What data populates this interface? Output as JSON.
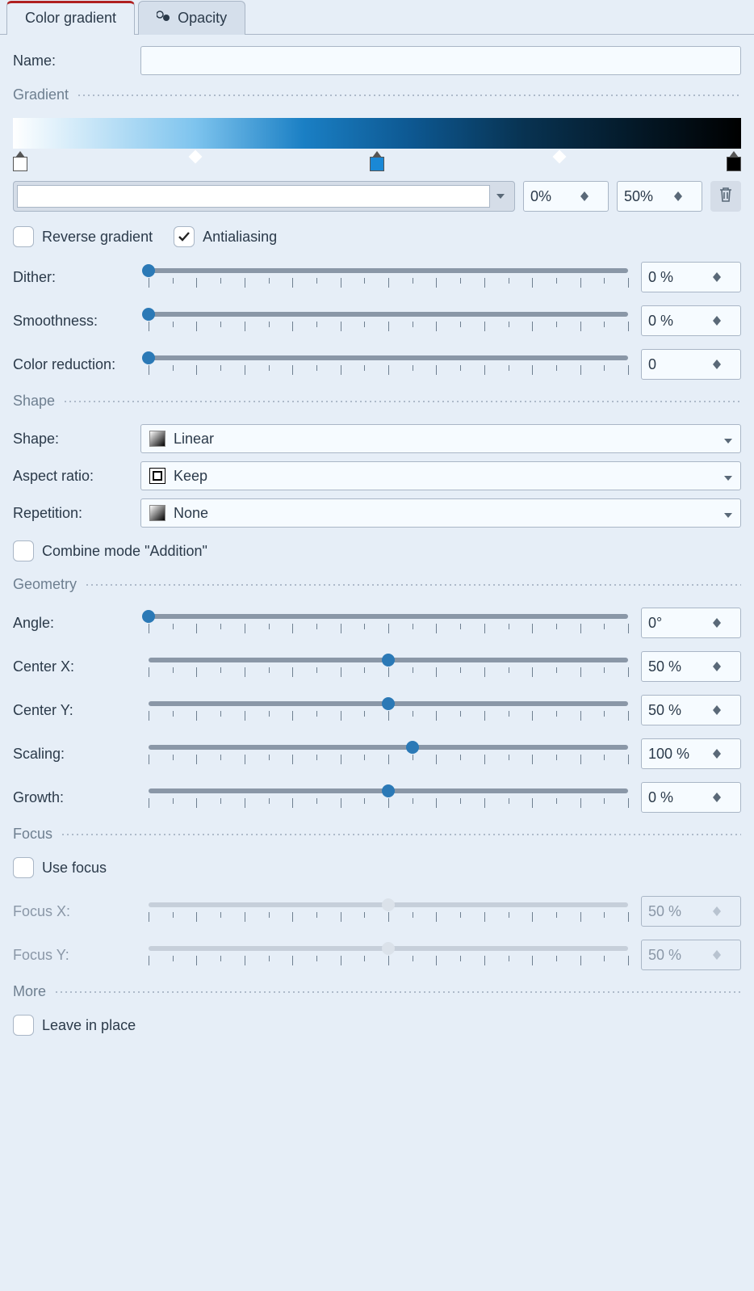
{
  "tabs": {
    "color_gradient": "Color gradient",
    "opacity": "Opacity"
  },
  "name": {
    "label": "Name:",
    "value": ""
  },
  "sections": {
    "gradient": "Gradient",
    "shape": "Shape",
    "geometry": "Geometry",
    "focus": "Focus",
    "more": "More"
  },
  "gradient": {
    "pos": "0%",
    "offset": "50%",
    "reverse_label": "Reverse gradient",
    "reverse_checked": false,
    "antialias_label": "Antialiasing",
    "antialias_checked": true
  },
  "sliders": {
    "dither": {
      "label": "Dither:",
      "value": "0 %",
      "pos": 0
    },
    "smoothness": {
      "label": "Smoothness:",
      "value": "0 %",
      "pos": 0
    },
    "color_reduction": {
      "label": "Color reduction:",
      "value": "0",
      "pos": 0
    },
    "angle": {
      "label": "Angle:",
      "value": "0°",
      "pos": 0
    },
    "center_x": {
      "label": "Center X:",
      "value": "50 %",
      "pos": 50
    },
    "center_y": {
      "label": "Center Y:",
      "value": "50 %",
      "pos": 50
    },
    "scaling": {
      "label": "Scaling:",
      "value": "100 %",
      "pos": 55
    },
    "growth": {
      "label": "Growth:",
      "value": "0 %",
      "pos": 50
    },
    "focus_x": {
      "label": "Focus X:",
      "value": "50 %",
      "pos": 50
    },
    "focus_y": {
      "label": "Focus Y:",
      "value": "50 %",
      "pos": 50
    }
  },
  "shape": {
    "shape_label": "Shape:",
    "shape_value": "Linear",
    "aspect_label": "Aspect ratio:",
    "aspect_value": "Keep",
    "repetition_label": "Repetition:",
    "repetition_value": "None",
    "combine_label": "Combine mode \"Addition\"",
    "combine_checked": false
  },
  "focus": {
    "use_label": "Use focus",
    "use_checked": false
  },
  "more": {
    "leave_label": "Leave in place",
    "leave_checked": false
  }
}
